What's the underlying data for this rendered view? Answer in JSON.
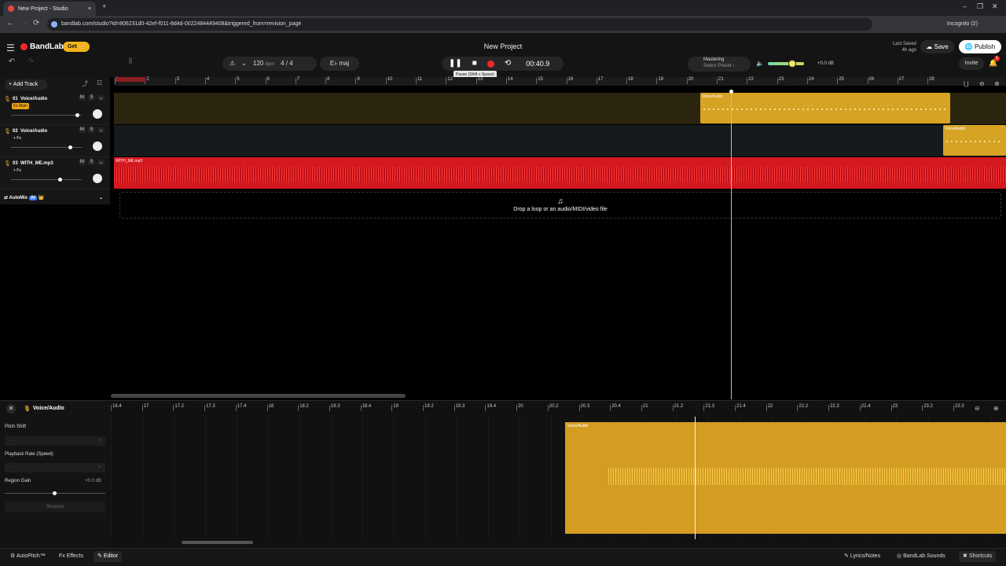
{
  "browser": {
    "tab_title": "New Project - Studio",
    "url": "bandlab.com/studio?id=806231d0-42ef-f011-8d4d-0022484449408&triggered_from=revision_page",
    "incognito": "Incognito (2)",
    "new_tab": "+",
    "tab_close": "×",
    "win_min": "–",
    "win_max": "❐",
    "win_close": "✕",
    "back": "←",
    "forward": "→",
    "reload": "⟳"
  },
  "header": {
    "menu_icon": "☰",
    "logo": "BandLab",
    "get": "Get 👑",
    "project_title": "New Project",
    "last_saved": "Last Saved",
    "last_saved_time": "4h ago",
    "save": "☁ Save",
    "publish": "🌐 Publish"
  },
  "toolbar": {
    "undo": "↶",
    "redo": "↷",
    "grid": "⦀",
    "tempo_icon": "⚠",
    "tempo_chevron": "⌄",
    "bpm": "120",
    "bpm_unit": "bpm",
    "time_sig": "4 / 4",
    "key": "E♭ maj",
    "pause": "❚❚",
    "stop": "■",
    "loop": "⟲",
    "time": "00:40.9",
    "tooltip": "Pause (Shift + Space)",
    "mastering": "Mastering",
    "mastering_preset": "Select Preset ›",
    "volume_icon": "🔈",
    "volume_db": "+0.0 dB",
    "invite": "Invite",
    "bell": "🔔",
    "notifications": "1"
  },
  "tracks_panel": {
    "add_track": "+ Add Track",
    "automix": "AutoMix",
    "automix_badge": "AI",
    "automix_crown": "👑",
    "chevron": "⌄",
    "tracks": [
      {
        "num": "01",
        "name": "Voice/Audio",
        "fx": "Fx Main",
        "mute": "M",
        "solo": "S",
        "volume": 0.95
      },
      {
        "num": "02",
        "name": "Voice/Audio",
        "fx": "+ Fx",
        "mute": "M",
        "solo": "S",
        "volume": 0.85
      },
      {
        "num": "03",
        "name": "WITH_ME.mp3",
        "fx": "+ Fx",
        "mute": "M",
        "solo": "S",
        "volume": 0.7
      }
    ]
  },
  "ruler": {
    "bars": [
      "1",
      "2",
      "3",
      "4",
      "5",
      "6",
      "7",
      "8",
      "9",
      "10",
      "11",
      "12",
      "13",
      "14",
      "15",
      "16",
      "17",
      "18",
      "19",
      "20",
      "21",
      "22",
      "23",
      "24",
      "25",
      "26",
      "27",
      "28"
    ]
  },
  "regions": {
    "track1_label": "Voice/Audio",
    "track2_label": "Voice/Audio",
    "track3_label": "WITH_ME.mp3"
  },
  "drop_area": {
    "icon": "♫",
    "text": "Drop a loop or an audio/MIDI/video file"
  },
  "editor": {
    "close": "✕",
    "title": "Voice/Audio",
    "pitch_shift": "Pitch Shift",
    "playback_rate": "Playback Rate (Speed)",
    "region_gain": "Region Gain",
    "gain_value": "+0.0 dB",
    "gain_level": 0.5,
    "minus": "–",
    "plus": "+",
    "reverse": "Reverse",
    "region_label": "Voice/Audio",
    "ruler": [
      "16.4",
      "17",
      "17.2",
      "17.3",
      "17.4",
      "18",
      "18.2",
      "18.3",
      "18.4",
      "19",
      "19.2",
      "19.3",
      "19.4",
      "20",
      "20.2",
      "20.3",
      "20.4",
      "21",
      "21.2",
      "21.3",
      "21.4",
      "22",
      "22.2",
      "22.3",
      "22.4",
      "23",
      "23.2",
      "23.3"
    ]
  },
  "bottom_bar": {
    "autopitch": "AutoPitch™",
    "effects": "Fx Effects",
    "editor": "Editor",
    "lyrics": "Lyrics/Notes",
    "sounds": "BandLab Sounds",
    "shortcuts": "Shortcuts"
  },
  "colors": {
    "accent": "#f2b21a",
    "record": "#f4262a",
    "voice_region": "#d6a324",
    "mp3_region": "#d3191f"
  }
}
